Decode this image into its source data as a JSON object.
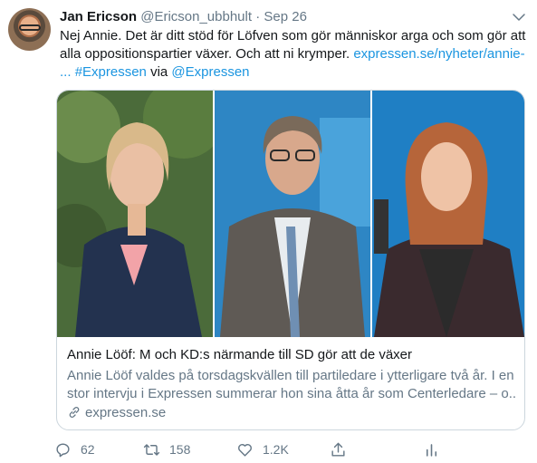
{
  "tweet": {
    "author_name": "Jan Ericson",
    "author_handle": "@Ericson_ubbhult",
    "separator": "·",
    "date": "Sep 26",
    "text_line1": "Nej Annie. Det är ditt stöd för Löfven som gör människor arga och som gör att",
    "text_line2_plain": "alla oppositionspartier växer. Och att ni krymper. ",
    "text_line2_link": "expressen.se/nyheter/annie-",
    "text_line3_link": "...",
    "text_line3_hashtag": "#Expressen",
    "text_line3_via": " via ",
    "text_line3_mention": "@Expressen"
  },
  "card": {
    "title": "Annie Lööf: M och KD:s närmande till SD gör att de växer",
    "description_line1": "Annie Lööf valdes på torsdagskvällen till partiledare i ytterligare två år. I en",
    "description_line2": "stor intervju i Expressen summerar hon sina åtta år som Centerledare – o...",
    "domain": "expressen.se"
  },
  "actions": {
    "replies": "62",
    "retweets": "158",
    "likes": "1.2K"
  },
  "colors": {
    "link": "#1b95e0",
    "secondary_text": "#657786",
    "border": "#ccd6dd"
  },
  "icons": [
    "chevron-down-icon",
    "link-icon",
    "reply-icon",
    "retweet-icon",
    "like-icon",
    "share-icon",
    "analytics-icon"
  ]
}
